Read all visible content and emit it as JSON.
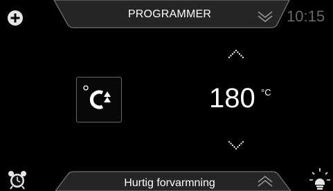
{
  "header": {
    "title": "PROGRAMMER",
    "clock": "10:15"
  },
  "main": {
    "mode_icon": "fast-preheat-icon",
    "temperature": "180",
    "unit": "°C"
  },
  "footer": {
    "title": "Hurtig forvarmning"
  },
  "icons": [
    "plus-icon",
    "chevron-down-icon",
    "chevron-up-icon",
    "alarm-clock-icon",
    "oven-light-icon",
    "temp-up-icon",
    "temp-down-icon"
  ],
  "colors": {
    "background": "#000000",
    "tab_fill": "#252525",
    "tab_border": "#8a8a8a",
    "text": "#ffffff",
    "dim_text": "#6a6a6a"
  }
}
